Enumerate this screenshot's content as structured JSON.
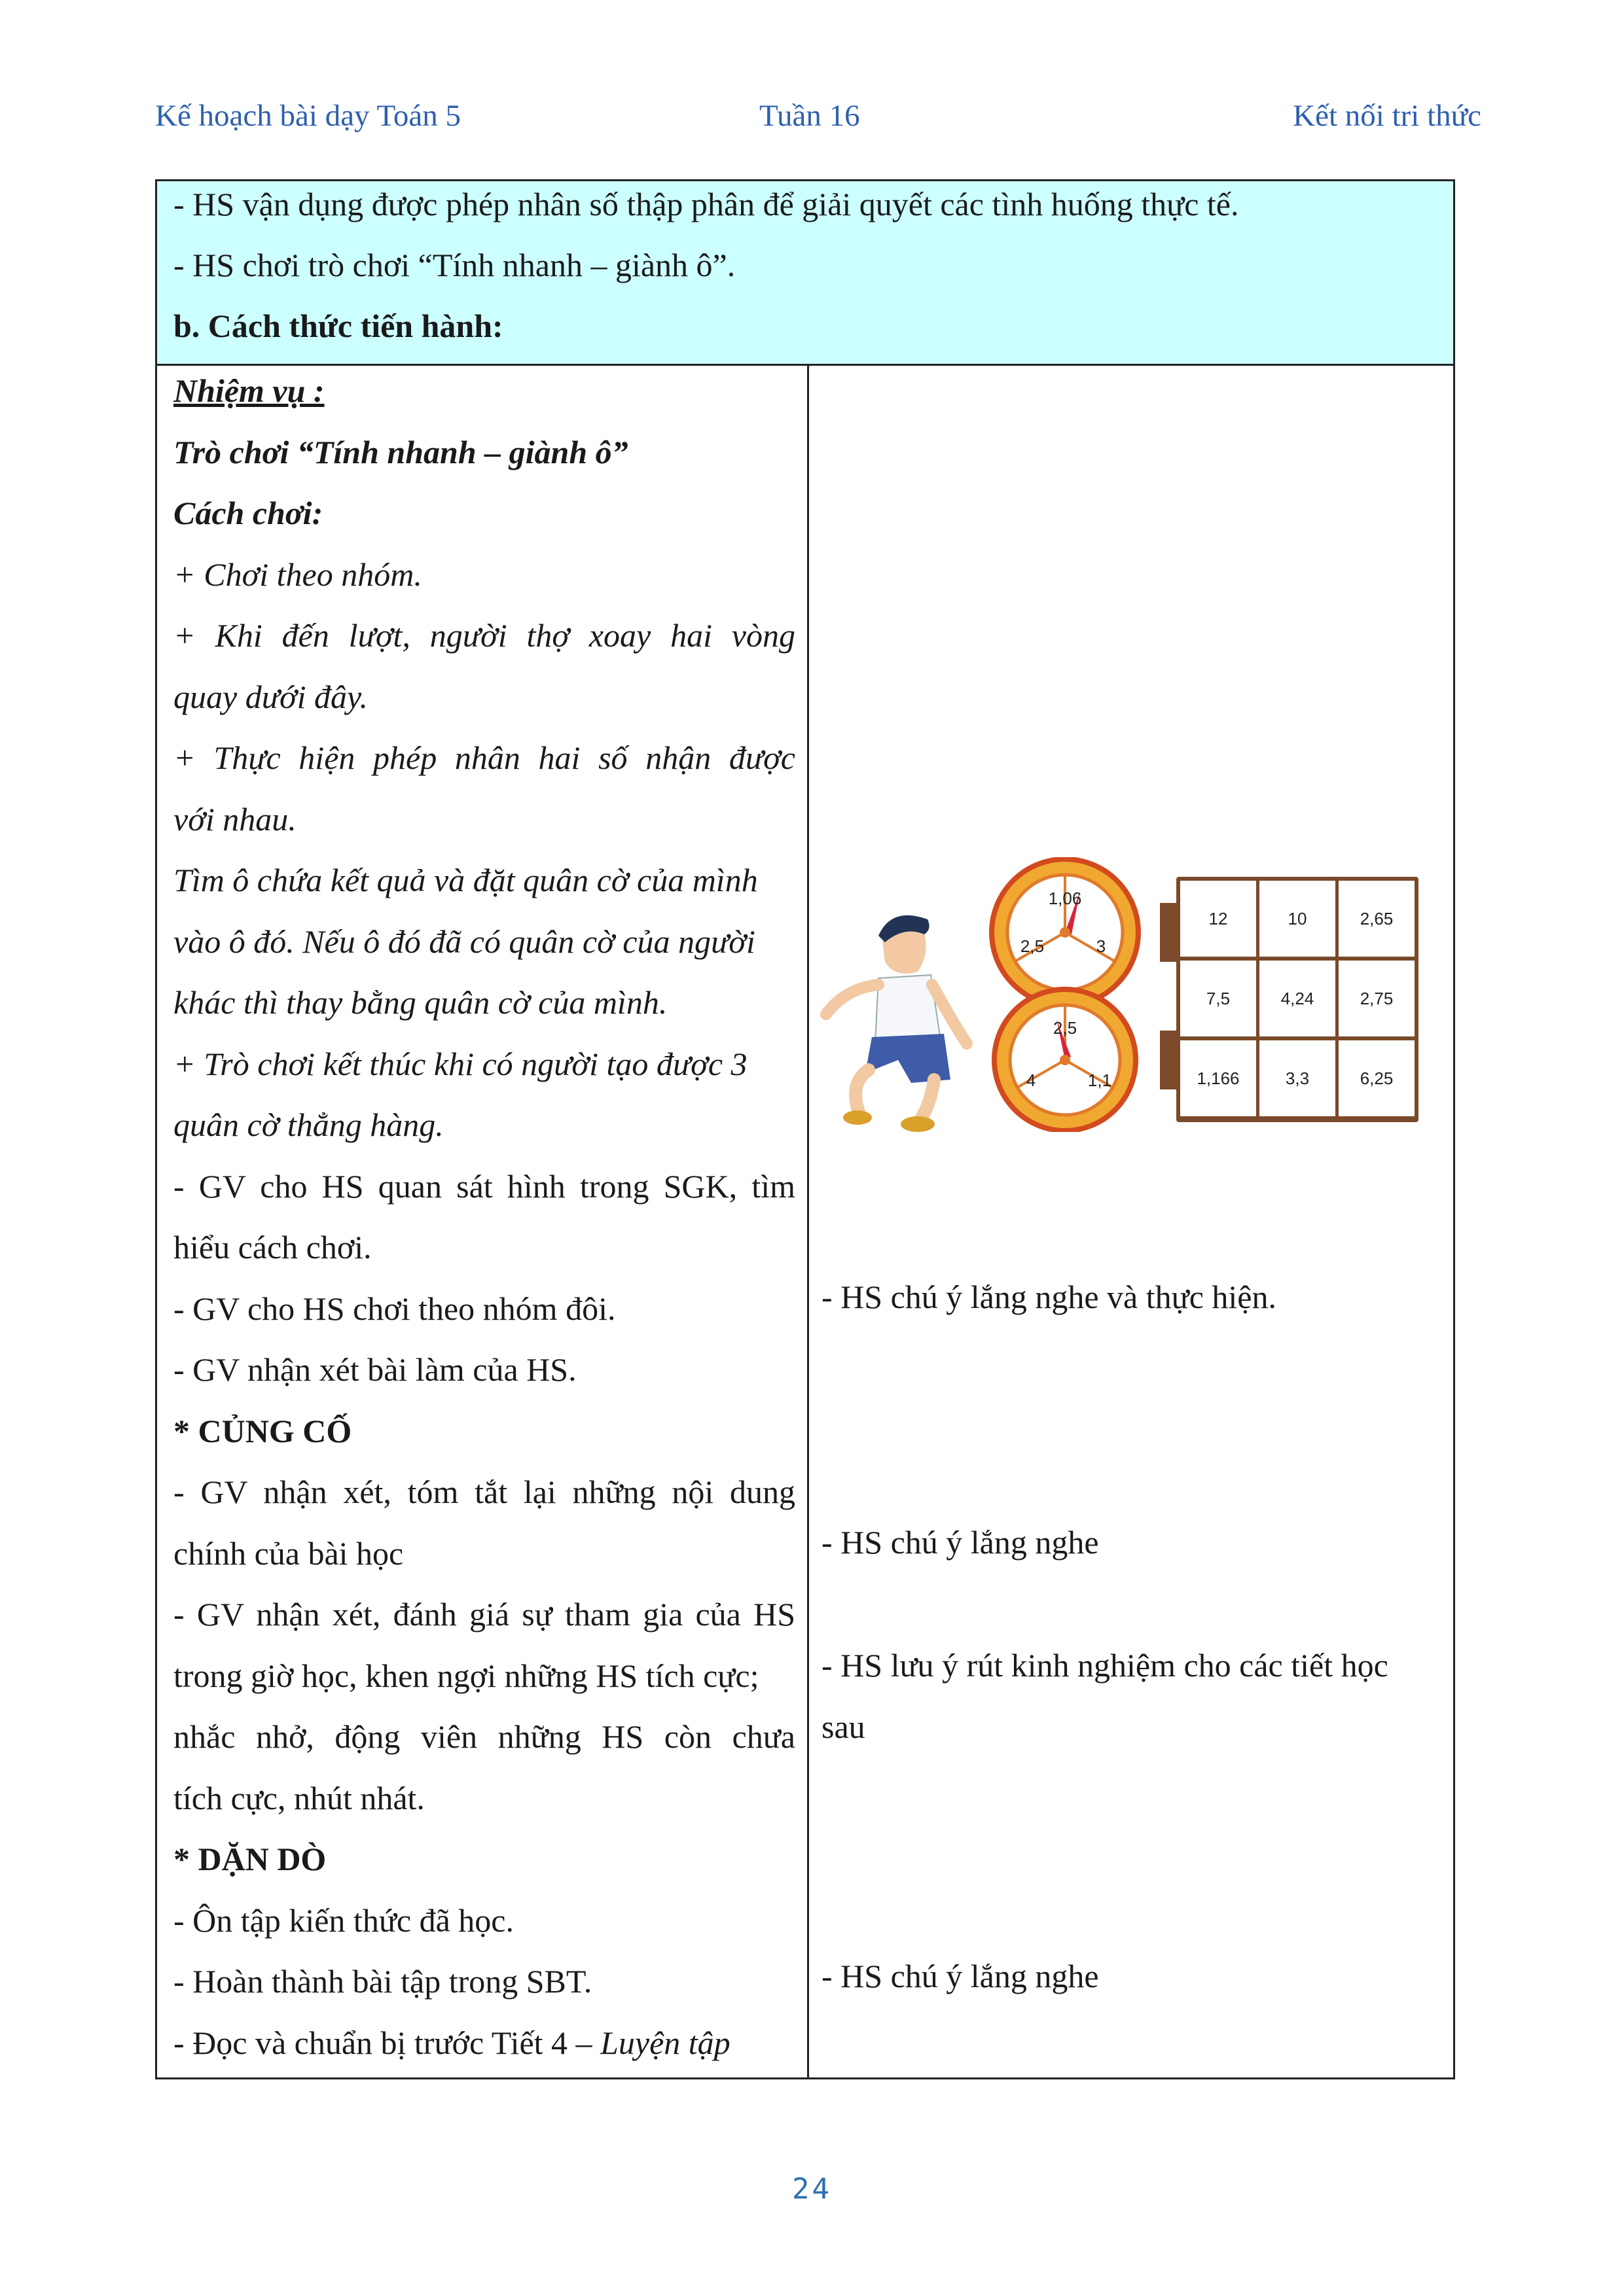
{
  "header": {
    "left": "Kế hoạch bài dạy Toán 5",
    "center": "Tuần 16",
    "right": "Kết nối tri thức"
  },
  "objectives": {
    "line1": "- HS vận dụng được phép nhân số thập phân để giải quyết các tình huống thực tế.",
    "line2": "- HS chơi trò chơi “Tính nhanh – giành ô”.",
    "section_heading": "b. Cách thức tiến hành:"
  },
  "left_column": {
    "task_label": "Nhiệm vụ :",
    "game_title": "Trò chơi “Tính nhanh – giành ô”",
    "howto_label": "Cách chơi:",
    "rule1": "+ Chơi theo nhóm.",
    "rule2_a": "+ Khi đến lượt, người thợ xoay hai vòng",
    "rule2_b": "quay dưới đây.",
    "rule3_a": "+ Thực hiện phép nhân hai số nhận được",
    "rule3_b": "với nhau.",
    "rule4_a": "Tìm ô chứa kết quả và đặt quân cờ của mình",
    "rule4_b": "vào ô đó. Nếu ô đó đã có quân cờ của người",
    "rule4_c": "khác thì thay bằng quân cờ của mình.",
    "rule5_a": "+ Trò chơi kết thúc khi có người tạo được 3",
    "rule5_b": "quân cờ thẳng hàng.",
    "gv1_a": "- GV cho HS quan sát hình trong SGK, tìm",
    "gv1_b": "hiểu cách chơi.",
    "gv2": "- GV cho HS chơi theo nhóm đôi.",
    "gv3": "- GV nhận xét bài làm của HS.",
    "consolidate_heading": "* CỦNG CỐ",
    "gv4_a": "- GV nhận xét, tóm tắt lại những nội dung",
    "gv4_b": "chính của bài học",
    "gv5_a": "- GV nhận xét, đánh giá sự tham gia của HS",
    "gv5_b": "trong giờ học, khen ngợi những HS tích cực;",
    "gv5_c": "nhắc nhở, động viên những HS còn chưa",
    "gv5_d": "tích cực, nhút nhát.",
    "homework_heading": "* DẶN DÒ",
    "hw1": "- Ôn tập kiến thức đã học.",
    "hw2": "- Hoàn thành bài tập trong SBT.",
    "hw3_prefix": "- Đọc và chuẩn bị trước Tiết 4 – ",
    "hw3_italic": "Luyện tập"
  },
  "right_column": {
    "resp1": "- HS chú ý lắng nghe và thực hiện.",
    "resp2": "- HS chú ý lắng nghe",
    "resp3_a": "- HS lưu ý rút kinh nghiệm cho các tiết học",
    "resp3_b": "sau",
    "resp4": "- HS chú ý lắng nghe"
  },
  "illustration": {
    "spinner_top": [
      "1,06",
      "2,5",
      "3"
    ],
    "spinner_bottom": [
      "2,5",
      "4",
      "1,1"
    ],
    "grid": [
      [
        "12",
        "10",
        "2,65"
      ],
      [
        "7,5",
        "4,24",
        "2,75"
      ],
      [
        "1,166",
        "3,3",
        "6,25"
      ]
    ]
  },
  "page_number": "24"
}
